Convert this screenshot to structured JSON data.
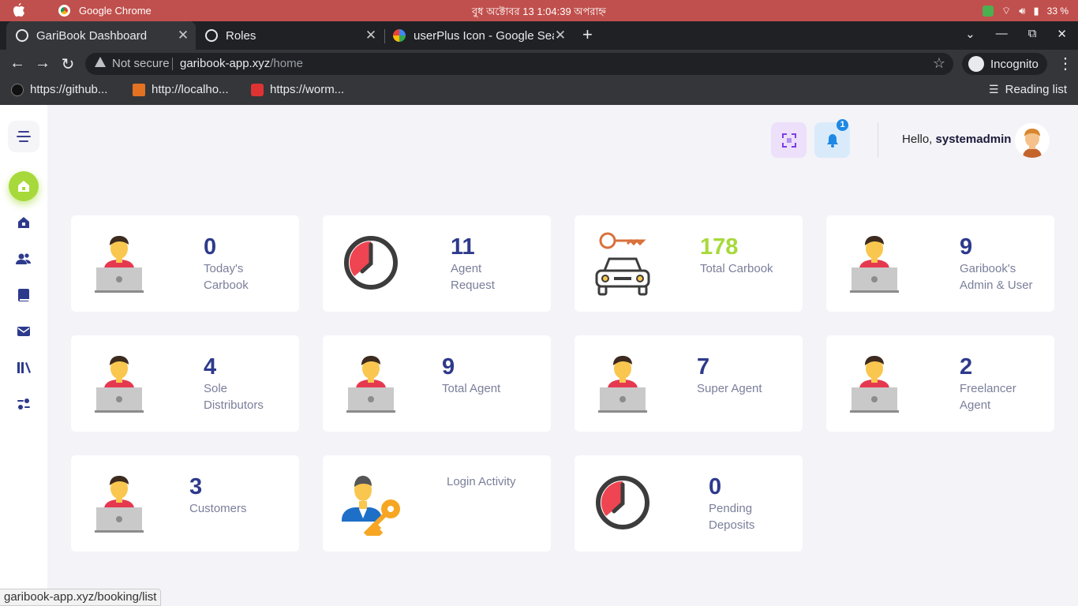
{
  "os": {
    "app_name": "Google Chrome",
    "clock": "বুধ অক্টোবর 13   1:04:39 অপরাহ্ন",
    "battery": "33 %"
  },
  "tabs": [
    {
      "title": "GariBook Dashboard",
      "active": true
    },
    {
      "title": "Roles",
      "active": false
    },
    {
      "title": "userPlus Icon - Google Sea",
      "active": false
    }
  ],
  "toolbar": {
    "not_secure": "Not secure",
    "url_host": "garibook-app.xyz",
    "url_path": "/home",
    "incognito": "Incognito"
  },
  "bookmarks": [
    "https://github...",
    "http://localho...",
    "https://worm..."
  ],
  "reading_list": "Reading list",
  "header": {
    "hello": "Hello,",
    "username": "systemadmin",
    "notification_count": "1"
  },
  "cards": [
    {
      "value": "0",
      "label": "Today's Carbook",
      "icon": "agent-laptop"
    },
    {
      "value": "11",
      "label": "Agent Request",
      "icon": "clock"
    },
    {
      "value": "178",
      "label": "Total Carbook",
      "icon": "car-key",
      "value_color": "#a7d93a"
    },
    {
      "value": "9",
      "label": "Garibook's Admin & User",
      "icon": "agent-laptop"
    },
    {
      "value": "4",
      "label": "Sole Distributors",
      "icon": "agent-laptop"
    },
    {
      "value": "9",
      "label": "Total Agent",
      "icon": "agent-laptop"
    },
    {
      "value": "7",
      "label": "Super Agent",
      "icon": "agent-laptop"
    },
    {
      "value": "2",
      "label": "Freelancer Agent",
      "icon": "agent-laptop"
    },
    {
      "value": "3",
      "label": "Customers",
      "icon": "agent-laptop"
    },
    {
      "value": "",
      "label": "Login Activity",
      "icon": "user-key"
    },
    {
      "value": "0",
      "label": "Pending Deposits",
      "icon": "clock"
    }
  ],
  "statusbar": "garibook-app.xyz/booking/list"
}
